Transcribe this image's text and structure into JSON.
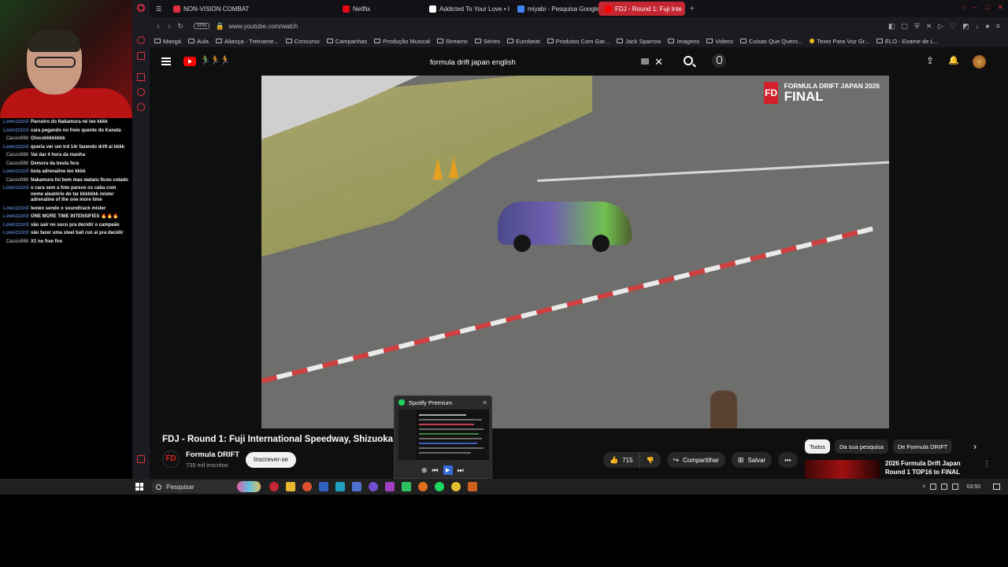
{
  "chat": [
    {
      "user": "Lorenzzzin3",
      "msg": "Parceiro do Nakamura né leo kkkk"
    },
    {
      "user": "Lorenzzzin3",
      "msg": "cara pegando no freio quente do Kanata"
    },
    {
      "user": "Cassio988",
      "msg": "Olocokkkkkkkk"
    },
    {
      "user": "Lorenzzzin3",
      "msg": "queria ver um trd 14r fazendo drift ai kkkk"
    },
    {
      "user": "Cassio988",
      "msg": "Vai dar 4 hora da manha"
    },
    {
      "user": "Cassio988",
      "msg": "Demora da besta fera"
    },
    {
      "user": "Lorenzzzin3",
      "msg": "bota adrenaline leo kkkk"
    },
    {
      "user": "Cassio988",
      "msg": "Nakamura foi bem mas wataru ficou colado"
    },
    {
      "user": "Lorenzzzin3",
      "msg": "o cara sem a foto parece os caba com nome aleatório do tar kkkkkkk mister adrenaline of the one more time"
    },
    {
      "user": "Lorenzzzin3",
      "msg": "leowo sendo o soundtrack mister"
    },
    {
      "user": "Lorenzzzin3",
      "msg": "ONE MORE TIME INTENSIFIES 🔥🔥🔥"
    },
    {
      "user": "Lorenzzzin3",
      "msg": "vão sair no soco pra decidir o campeão"
    },
    {
      "user": "Lorenzzzin3",
      "msg": "vão fazer uma steel ball run aí pra decidir"
    },
    {
      "user": "Cassio988",
      "msg": "X1 no free fire"
    }
  ],
  "tabs": [
    {
      "label": "NON-VISION COMBAT",
      "color": "#e03040"
    },
    {
      "label": "Netflix",
      "color": "#e50914"
    },
    {
      "label": "Addicted To Your Love • I",
      "color": "#ffffff"
    },
    {
      "label": "miyabi - Pesquisa Google",
      "color": "#4285f4"
    },
    {
      "label": "FDJ - Round 1: Fuji Inte",
      "color": "#ff0000"
    }
  ],
  "address": {
    "vpn": "VPN",
    "url": "www.youtube.com/watch"
  },
  "bookmarks": [
    "Mangá",
    "Aula",
    "Aliança - Treiname...",
    "Concurso",
    "Campanhas",
    "Produção Musical",
    "Streams",
    "Séries",
    "Eurobeat",
    "Produtos Com Gar...",
    "Jack Sparrow",
    "Imagens",
    "Videos",
    "Coisas Que Quero...",
    "Texto Para Voz Gr...",
    "ELO - Exame de L..."
  ],
  "youtube": {
    "doodle": "🏃‍♂️🏃🏃",
    "search_value": "formula drift japan english",
    "overlay_sub": "FORMULA DRIFT JAPAN 2026",
    "overlay_big": "FINAL",
    "overlay_badge": "FD",
    "video_title": "FDJ - Round 1: Fuji International Speedway, Shizuoka - T",
    "channel_name": "Formula DRIFT",
    "channel_subs": "735 mil inscritos",
    "subscribe": "Inscrever-se",
    "likes": "715",
    "share": "Compartilhar",
    "save": "Salvar",
    "more": "•••",
    "chips": [
      "Todos",
      "Da sua pesquisa",
      "De Formula DRIFT"
    ],
    "rec_title": "2026 Formula Drift Japan Round 1 TOP16 to FINAL"
  },
  "spotify": {
    "title": "Spotify Premium"
  },
  "taskbar": {
    "search": "Pesquisar",
    "time": "03:50"
  },
  "colors": {
    "yt_bg": "#0f0f0f",
    "opera_red": "#c42632",
    "spotify_green": "#1ed760"
  }
}
